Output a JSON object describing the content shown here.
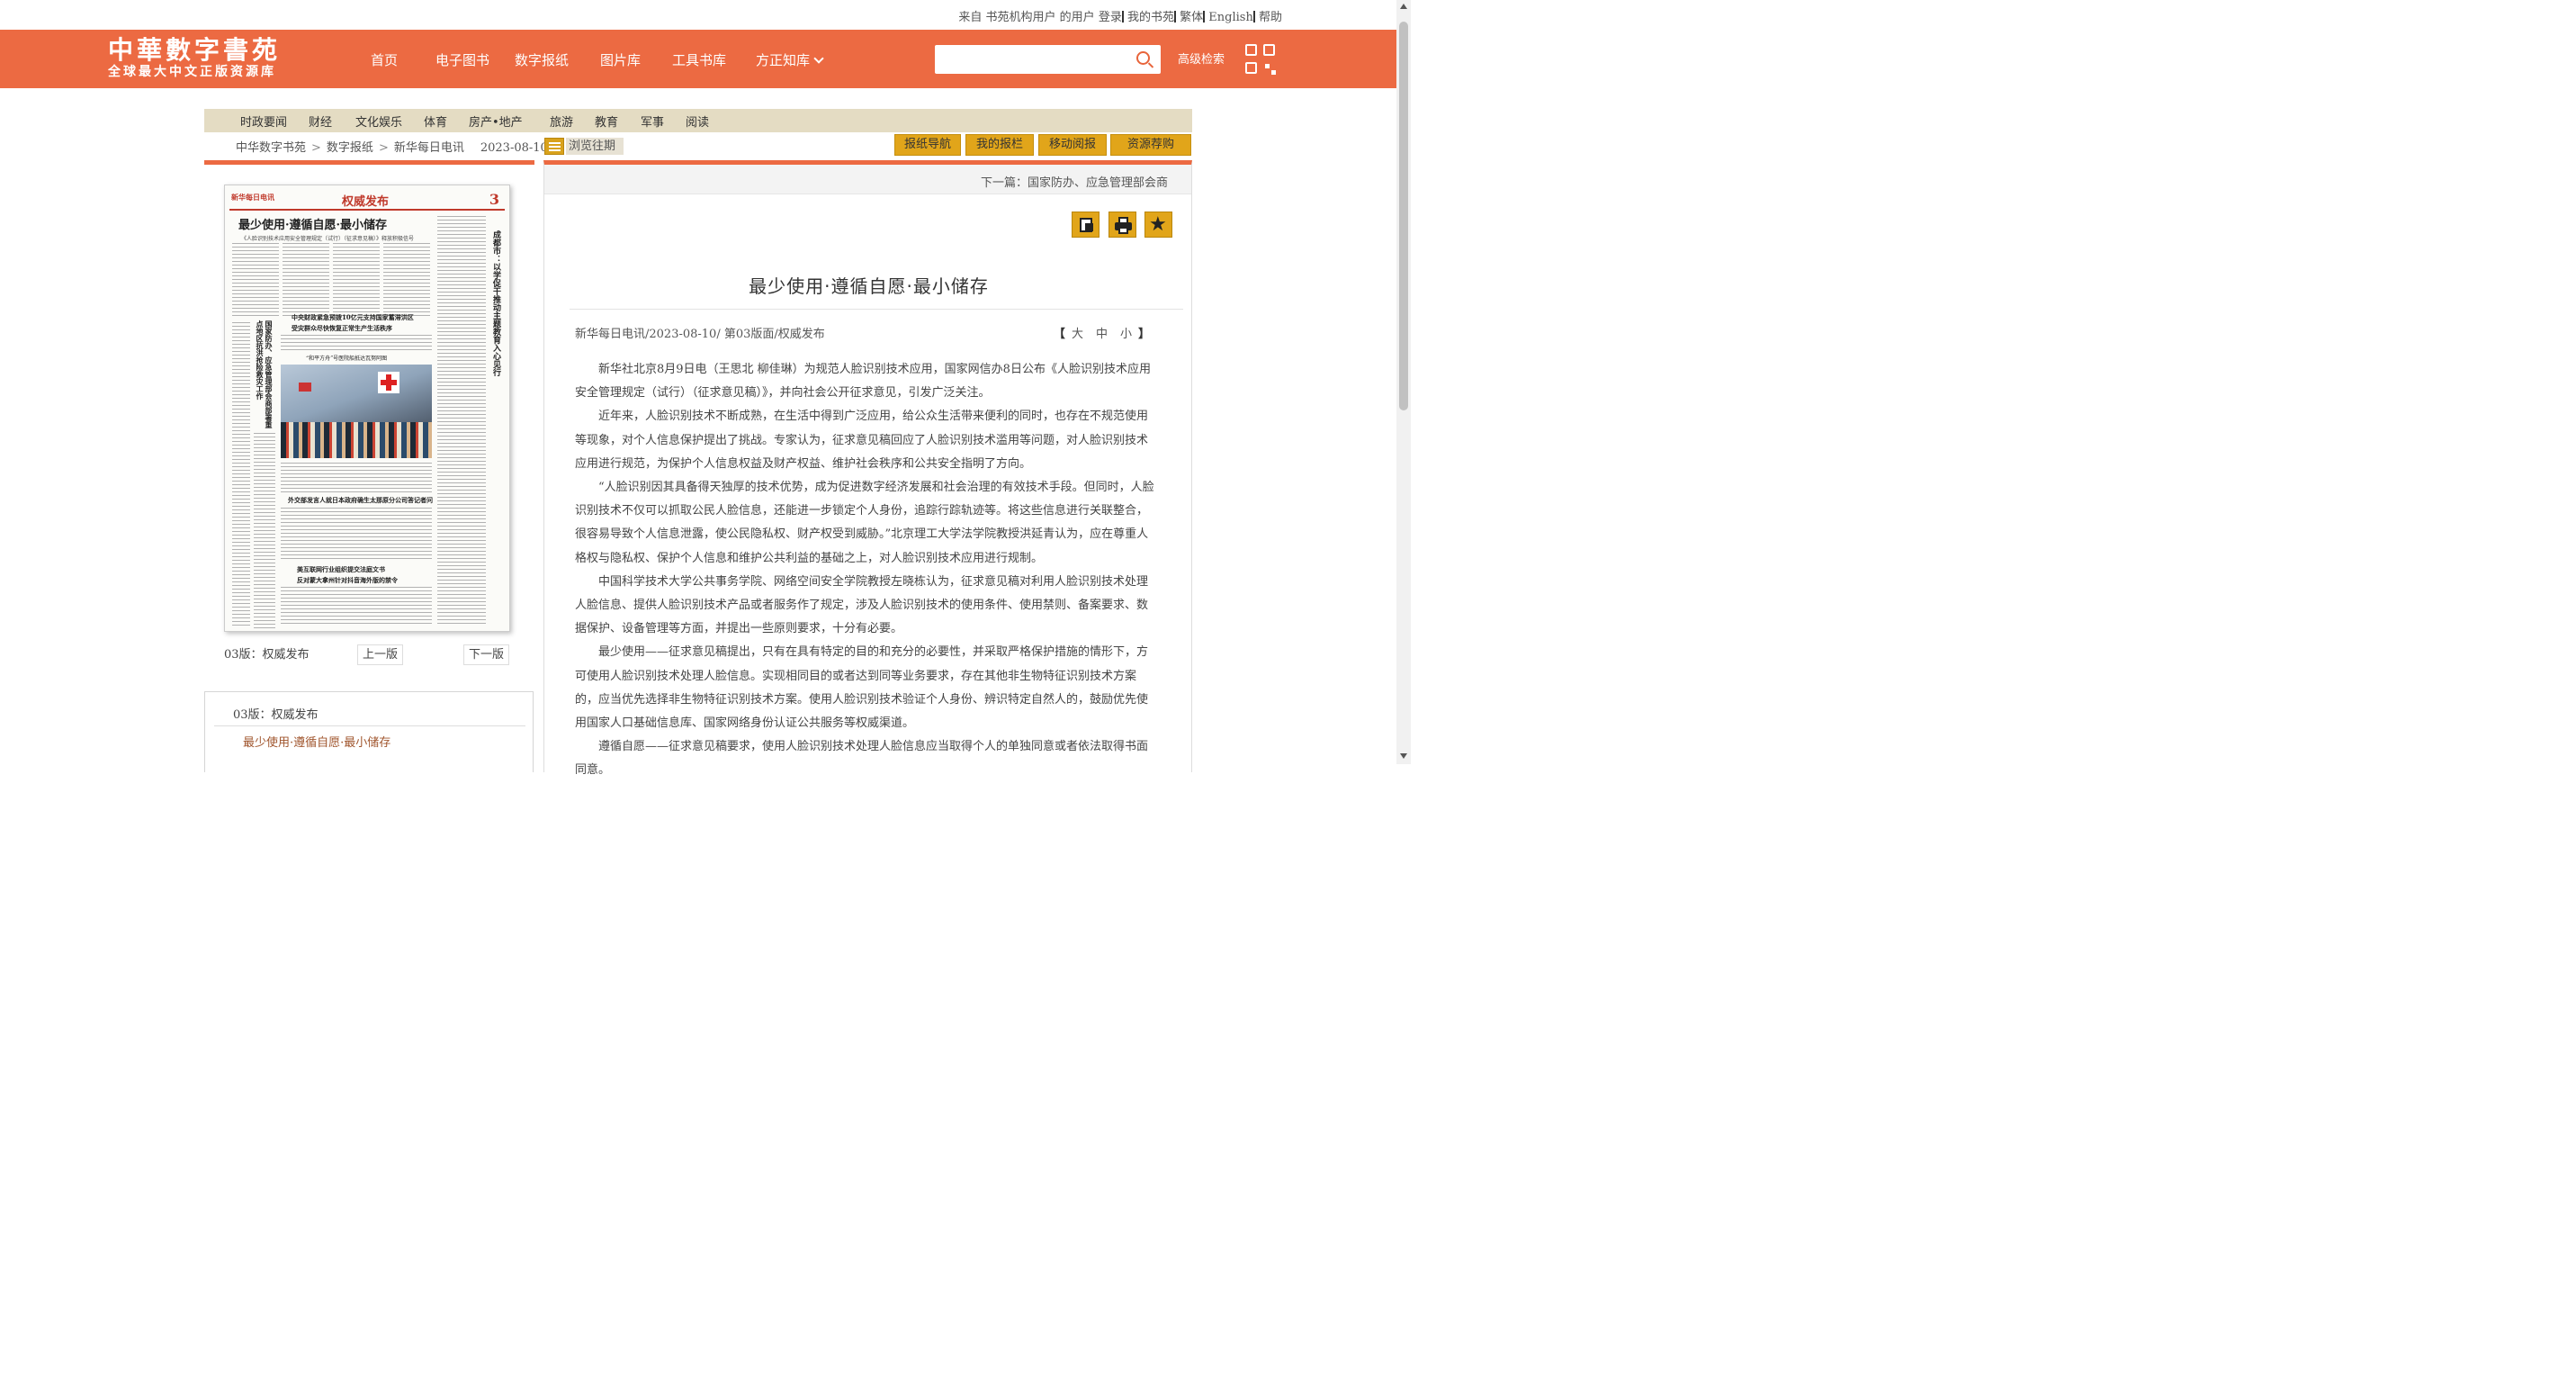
{
  "topbar": {
    "from_user": "来自 书苑机构用户 的用户",
    "links": [
      "登录",
      "我的书苑",
      "繁体",
      "English",
      "帮助"
    ]
  },
  "header": {
    "logo_title": "中華數字書苑",
    "logo_sub": "全球最大中文正版资源库",
    "nav": [
      "首页",
      "电子图书",
      "数字报纸",
      "图片库",
      "工具书库",
      "方正知库"
    ],
    "search_placeholder": "",
    "advanced_search": "高级检索",
    "brand_color": "#ec6a42"
  },
  "categories": [
    "时政要闻",
    "财经",
    "文化娱乐",
    "体育",
    "房产•地产",
    "旅游",
    "教育",
    "军事",
    "阅读"
  ],
  "breadcrumb": {
    "items": [
      "中华数字书苑",
      "数字报纸",
      "新华每日电讯"
    ],
    "date": "2023-08-10",
    "browse_past": "浏览往期"
  },
  "tool_buttons": [
    "报纸导航",
    "我的报栏",
    "移动阅报",
    "资源荐购"
  ],
  "paper": {
    "masthead": "新华每日电讯",
    "section": "权威发布",
    "page_number": "3",
    "headline": "最少使用·遵循自愿·最小储存",
    "subhead": "《人脸识别技术应用安全管理规定（试行）（征求意见稿）》释放积极信号",
    "side_headline_1": "成都市：以学促干推动主题教育入心见行",
    "side_headline_2": "国家防办、应急管理部会商部署重点地区抗洪抢险救灾工作",
    "mid_headline_1": "中央财政紧急预拨10亿元支持国家蓄滞洪区",
    "mid_headline_2": "受灾群众尽快恢复正常生产生活秩序",
    "photo_caption": "“和平方舟”号医院船抵达瓦努阿图",
    "mid_headline_3": "外交部发言人就日本政府确生太那原分公司答记者问",
    "mid_headline_4": "美互联网行业组织提交法庭文书",
    "mid_headline_5": "反对蒙大拿州针对抖音海外版的禁令"
  },
  "page_nav": {
    "current": "03版：权威发布",
    "prev": "上一版",
    "next": "下一版"
  },
  "toc": {
    "header": "03版：权威发布",
    "items": [
      "最少使用·遵循自愿·最小储存"
    ]
  },
  "article": {
    "next_article": "下一篇：国家防办、应急管理部会商",
    "action_icons": [
      "save-icon",
      "print-icon",
      "favorite-star-icon"
    ],
    "title": "最少使用·遵循自愿·最小储存",
    "meta": "新华每日电讯/2023-08-10/ 第03版面/权威发布",
    "font_size": {
      "open": "【",
      "large": "大",
      "medium": "中",
      "small": "小",
      "close": "】"
    },
    "paragraphs": [
      "新华社北京8月9日电（王思北 柳佳琳）为规范人脸识别技术应用，国家网信办8日公布《人脸识别技术应用安全管理规定（试行）（征求意见稿）》，并向社会公开征求意见，引发广泛关注。",
      "近年来，人脸识别技术不断成熟，在生活中得到广泛应用，给公众生活带来便利的同时，也存在不规范使用等现象，对个人信息保护提出了挑战。专家认为，征求意见稿回应了人脸识别技术滥用等问题，对人脸识别技术应用进行规范，为保护个人信息权益及财产权益、维护社会秩序和公共安全指明了方向。",
      "“人脸识别因其具备得天独厚的技术优势，成为促进数字经济发展和社会治理的有效技术手段。但同时，人脸识别技术不仅可以抓取公民人脸信息，还能进一步锁定个人身份，追踪行踪轨迹等。将这些信息进行关联整合，很容易导致个人信息泄露，使公民隐私权、财产权受到威胁。”北京理工大学法学院教授洪延青认为，应在尊重人格权与隐私权、保护个人信息和维护公共利益的基础之上，对人脸识别技术应用进行规制。",
      "中国科学技术大学公共事务学院、网络空间安全学院教授左晓栋认为，征求意见稿对利用人脸识别技术处理人脸信息、提供人脸识别技术产品或者服务作了规定，涉及人脸识别技术的使用条件、使用禁则、备案要求、数据保护、设备管理等方面，并提出一些原则要求，十分有必要。",
      "最少使用——征求意见稿提出，只有在具有特定的目的和充分的必要性，并采取严格保护措施的情形下，方可使用人脸识别技术处理人脸信息。实现相同目的或者达到同等业务要求，存在其他非生物特征识别技术方案的，应当优先选择非生物特征识别技术方案。使用人脸识别技术验证个人身份、辨识特定自然人的，鼓励优先使用国家人口基础信息库、国家网络身份认证公共服务等权威渠道。",
      "遵循自愿——征求意见稿要求，使用人脸识别技术处理人脸信息应当取得个人的单独同意或者依法取得书面同意。"
    ]
  }
}
